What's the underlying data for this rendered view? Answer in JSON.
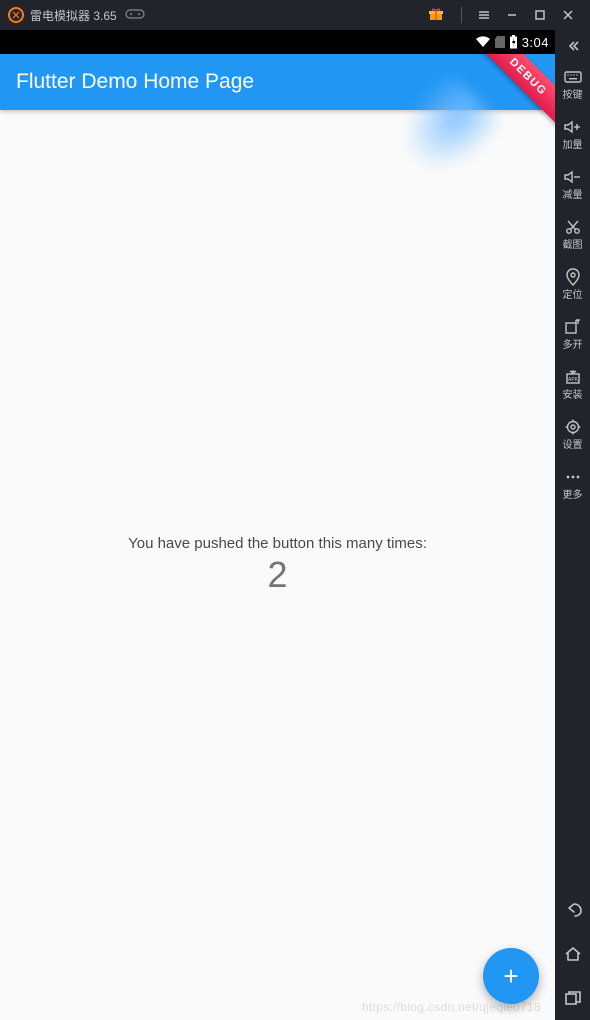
{
  "titlebar": {
    "app_name": "雷电模拟器",
    "version": "3.65"
  },
  "android": {
    "clock": "3:04",
    "debug_banner": "DEBUG"
  },
  "flutter": {
    "appbar_title": "Flutter Demo Home Page",
    "push_text": "You have pushed the button this many times:",
    "counter": "2"
  },
  "right_toolbar": {
    "items": [
      {
        "icon": "keyboard",
        "label": "按键"
      },
      {
        "icon": "volume-up",
        "label": "加量"
      },
      {
        "icon": "volume-down",
        "label": "减量"
      },
      {
        "icon": "scissors",
        "label": "截图"
      },
      {
        "icon": "location",
        "label": "定位"
      },
      {
        "icon": "multi",
        "label": "多开"
      },
      {
        "icon": "apk",
        "label": "安装"
      },
      {
        "icon": "gear",
        "label": "设置"
      },
      {
        "icon": "more",
        "label": "更多"
      }
    ]
  },
  "watermark": "https://blog.csdn.net/qjeqie0718"
}
